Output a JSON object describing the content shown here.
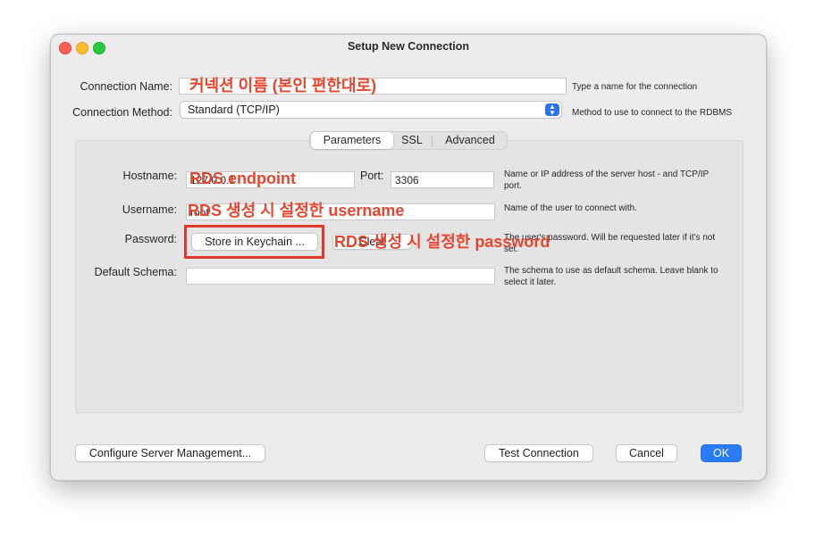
{
  "window": {
    "title": "Setup New Connection"
  },
  "connection": {
    "name_label": "Connection Name:",
    "name_hint": "Type a name for the connection",
    "method_label": "Connection Method:",
    "method_value": "Standard (TCP/IP)",
    "method_hint": "Method to use to connect to the RDBMS"
  },
  "tabs": [
    {
      "label": "Parameters",
      "active": true
    },
    {
      "label": "SSL",
      "active": false
    },
    {
      "label": "Advanced",
      "active": false
    }
  ],
  "params": {
    "hostname_label": "Hostname:",
    "hostname_value": "127.0.0.1",
    "port_label": "Port:",
    "port_value": "3306",
    "hostname_hint": "Name or IP address of the server host - and TCP/IP port.",
    "username_label": "Username:",
    "username_value": "root",
    "username_hint": "Name of the user to connect with.",
    "password_label": "Password:",
    "store_button": "Store in Keychain ...",
    "clear_button": "Clear",
    "password_hint": "The user's password. Will be requested later if it's not set.",
    "schema_label": "Default Schema:",
    "schema_value": "",
    "schema_hint": "The schema to use as default schema. Leave blank to select it later."
  },
  "footer": {
    "configure_button": "Configure Server Management...",
    "test_button": "Test Connection",
    "cancel_button": "Cancel",
    "ok_button": "OK"
  },
  "annotations": {
    "connection_name": "커넥션 이름 (본인 편한대로)",
    "hostname": "RDS endpoint",
    "username": "RDS 생성 시 설정한 username",
    "password": "RDS 생성 시 설정한 password",
    "color": "#e8452f"
  }
}
